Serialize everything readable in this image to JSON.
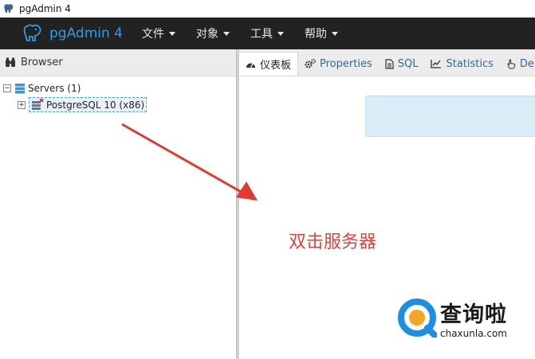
{
  "window": {
    "title": "pgAdmin 4"
  },
  "navbar": {
    "brand": "pgAdmin 4",
    "menus": [
      {
        "label": "文件"
      },
      {
        "label": "对象"
      },
      {
        "label": "工具"
      },
      {
        "label": "帮助"
      }
    ]
  },
  "browser": {
    "title": "Browser",
    "tree": {
      "servers_label": "Servers (1)",
      "server_label": "PostgreSQL 10 (x86)"
    }
  },
  "tabs": [
    {
      "label": "仪表板",
      "icon": "dashboard-icon",
      "active": true
    },
    {
      "label": "Properties",
      "icon": "gears-icon"
    },
    {
      "label": "SQL",
      "icon": "file-icon"
    },
    {
      "label": "Statistics",
      "icon": "line-chart-icon"
    },
    {
      "label": "Deper",
      "icon": "hand-pointer-icon"
    }
  ],
  "annotation": {
    "text": "双击服务器"
  },
  "watermark": {
    "cn": "查询啦",
    "url": "chaxunla.com"
  },
  "colors": {
    "navbar_bg": "#222222",
    "brand": "#2f9de0",
    "annotation": "#d9453a",
    "info_box": "#d9edf7",
    "tab_link": "#2c6aa0"
  }
}
